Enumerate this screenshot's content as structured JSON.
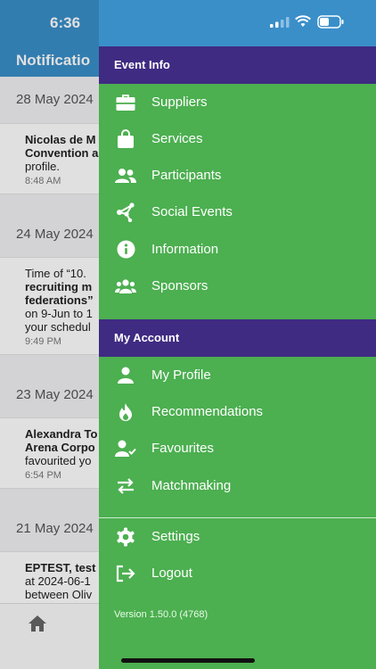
{
  "background": {
    "time": "6:36",
    "title": "Notificatio",
    "groups": [
      {
        "date": "28 May 2024",
        "lines": [
          {
            "text": "Nicolas de M",
            "bold": true
          },
          {
            "text": "Convention a",
            "bold": true
          },
          {
            "text": "profile.",
            "bold": false
          }
        ],
        "time": "8:48 AM"
      },
      {
        "date": "24 May 2024",
        "lines": [
          {
            "text": "Time of “10.",
            "bold": false
          },
          {
            "text": "recruiting m",
            "bold": true
          },
          {
            "text": "federations”",
            "bold": true
          },
          {
            "text": "on 9-Jun to 1",
            "bold": false
          },
          {
            "text": "your schedul",
            "bold": false
          }
        ],
        "time": "9:49 PM"
      },
      {
        "date": "23 May 2024",
        "lines": [
          {
            "text": "Alexandra To",
            "bold": true
          },
          {
            "text": "Arena Corpo",
            "bold": true
          },
          {
            "text": "favourited yo",
            "bold": false
          }
        ],
        "time": "6:54 PM"
      },
      {
        "date": "21 May 2024",
        "lines": [
          {
            "text": "EPTEST, test",
            "bold": true
          },
          {
            "text": "at 2024-06-1",
            "bold": false
          },
          {
            "text": "between Oliv",
            "bold": false
          }
        ],
        "time": ""
      }
    ]
  },
  "drawer": {
    "event_info": {
      "header": "Event Info",
      "items": [
        {
          "label": "Suppliers",
          "icon": "briefcase-icon"
        },
        {
          "label": "Services",
          "icon": "shopping-bag-icon"
        },
        {
          "label": "Participants",
          "icon": "people-icon"
        },
        {
          "label": "Social Events",
          "icon": "share-network-icon"
        },
        {
          "label": "Information",
          "icon": "info-icon"
        },
        {
          "label": "Sponsors",
          "icon": "group-icon"
        }
      ]
    },
    "my_account": {
      "header": "My Account",
      "items": [
        {
          "label": "My Profile",
          "icon": "person-icon"
        },
        {
          "label": "Recommendations",
          "icon": "fire-icon"
        },
        {
          "label": "Favourites",
          "icon": "person-check-icon"
        },
        {
          "label": "Matchmaking",
          "icon": "swap-arrows-icon"
        }
      ]
    },
    "footer_items": [
      {
        "label": "Settings",
        "icon": "gear-icon"
      },
      {
        "label": "Logout",
        "icon": "logout-icon"
      }
    ],
    "version": "Version 1.50.0 (4768)"
  },
  "colors": {
    "status_bar": "#3a8fc9",
    "section_header": "#3f2b82",
    "drawer_bg": "#4caf50"
  }
}
